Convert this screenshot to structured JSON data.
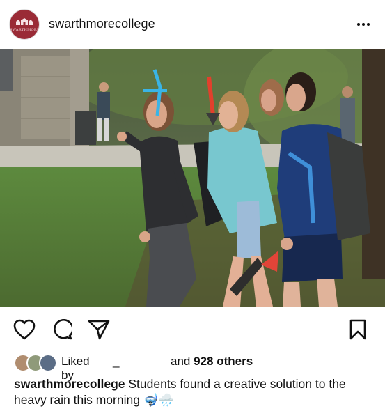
{
  "account": {
    "username": "swarthmorecollege",
    "logo_text": "SWARTHMORE"
  },
  "icons": {
    "more": "more-dots-icon",
    "like": "heart-icon",
    "comment": "comment-icon",
    "share": "send-icon",
    "save": "bookmark-icon"
  },
  "likes": {
    "prefix": "Liked by",
    "user": "_",
    "middle": "and",
    "count_text": "928 others"
  },
  "caption": {
    "username": "swarthmorecollege",
    "text": "Students found a creative solution to the heavy rain this morning",
    "emojis": "🤿🌧️"
  }
}
